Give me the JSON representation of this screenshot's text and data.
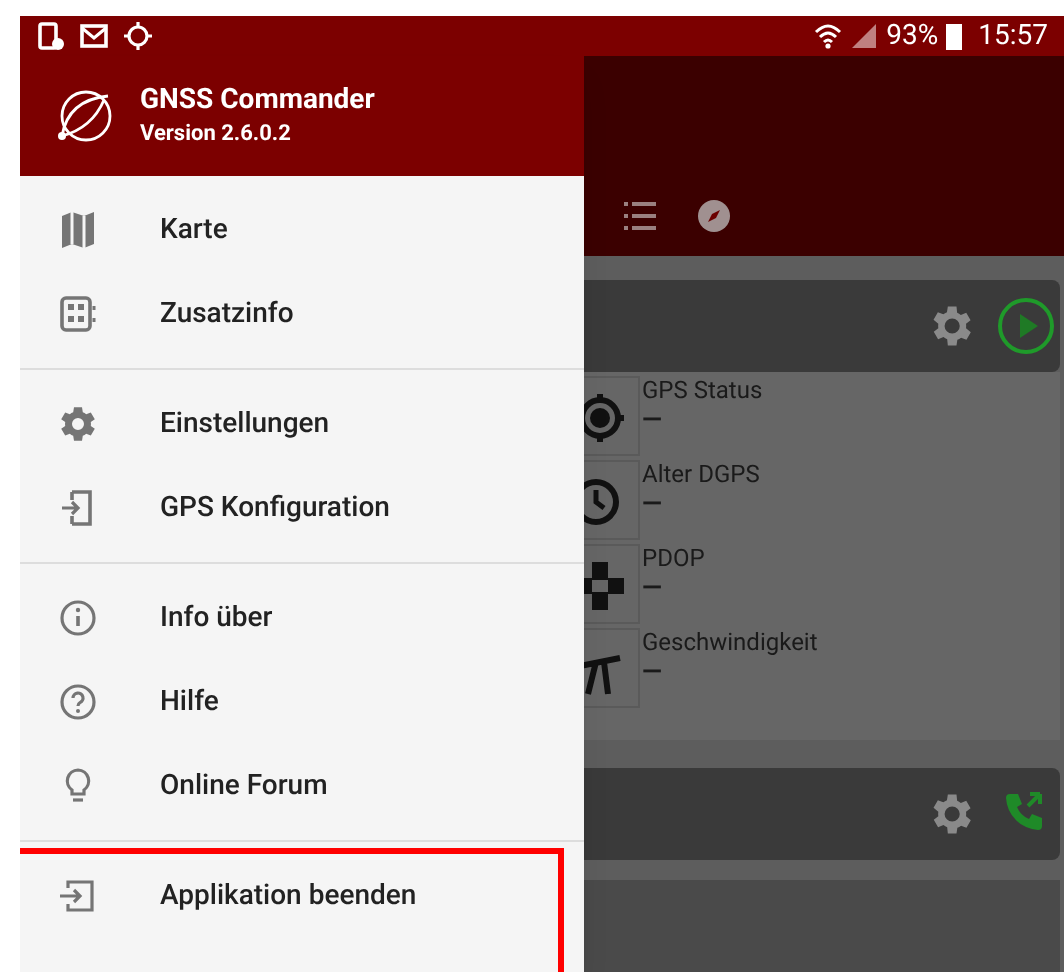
{
  "status_bar": {
    "battery": "93%",
    "time": "15:57"
  },
  "drawer": {
    "title": "GNSS Commander",
    "version": "Version 2.6.0.2",
    "groups": [
      {
        "items": [
          {
            "label": "Karte"
          },
          {
            "label": "Zusatzinfo"
          }
        ]
      },
      {
        "items": [
          {
            "label": "Einstellungen"
          },
          {
            "label": "GPS Konfiguration"
          }
        ]
      },
      {
        "items": [
          {
            "label": "Info über"
          },
          {
            "label": "Hilfe"
          },
          {
            "label": "Online Forum"
          }
        ]
      },
      {
        "items": [
          {
            "label": "Applikation beenden"
          }
        ]
      }
    ]
  },
  "background": {
    "fields": [
      {
        "label": "GPS Status",
        "value": "—"
      },
      {
        "label": "Alter DGPS",
        "value": "—"
      },
      {
        "label": "PDOP",
        "value": "—"
      },
      {
        "label": "Geschwindigkeit",
        "value": "—"
      }
    ]
  }
}
